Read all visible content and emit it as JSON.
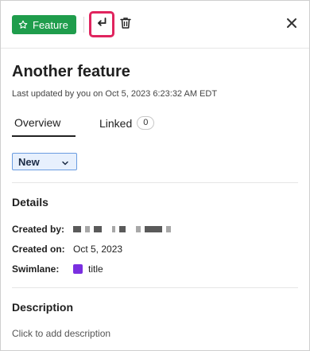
{
  "toolbar": {
    "type_label": "Feature",
    "type_color": "#1f9d4c",
    "type_icon": "star-outline-icon",
    "convert_icon": "return-arrow-icon",
    "delete_icon": "trash-icon",
    "close_icon": "close-icon",
    "highlight_color": "#e0245e"
  },
  "item": {
    "title": "Another feature",
    "last_updated": "Last updated by you on Oct 5, 2023 6:23:32 AM EDT"
  },
  "tabs": {
    "overview": "Overview",
    "linked": "Linked",
    "linked_count": "0"
  },
  "status": {
    "value": "New"
  },
  "details": {
    "heading": "Details",
    "created_by_label": "Created by:",
    "created_on_label": "Created on:",
    "created_on_value": "Oct 5, 2023",
    "swimlane_label": "Swimlane:",
    "swimlane_value": "title",
    "swimlane_color": "#7a2fe0"
  },
  "description": {
    "heading": "Description",
    "placeholder": "Click to add description"
  }
}
